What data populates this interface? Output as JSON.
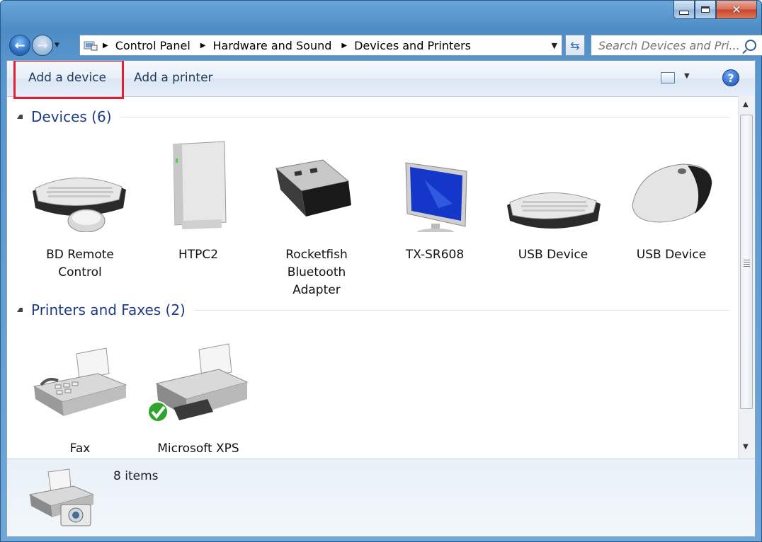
{
  "window": {
    "title": "Devices and Printers"
  },
  "nav": {
    "breadcrumbs": [
      "Control Panel",
      "Hardware and Sound",
      "Devices and Printers"
    ]
  },
  "search": {
    "placeholder": "Search Devices and Pri..."
  },
  "toolbar": {
    "add_device": "Add a device",
    "add_printer": "Add a printer",
    "help": "?"
  },
  "groups": {
    "devices": {
      "title": "Devices (6)",
      "items": [
        {
          "label": "BD Remote Control",
          "icon": "keyboard-mouse-icon"
        },
        {
          "label": "HTPC2",
          "icon": "computer-tower-icon"
        },
        {
          "label": "Rocketfish Bluetooth Adapter",
          "icon": "usb-dongle-icon"
        },
        {
          "label": "TX-SR608",
          "icon": "monitor-icon"
        },
        {
          "label": "USB Device",
          "icon": "keyboard-icon"
        },
        {
          "label": "USB Device",
          "icon": "mouse-icon"
        }
      ]
    },
    "printers": {
      "title": "Printers and Faxes (2)",
      "items": [
        {
          "label": "Fax",
          "icon": "fax-icon"
        },
        {
          "label": "Microsoft XPS Document Writer",
          "icon": "printer-icon"
        }
      ]
    }
  },
  "details": {
    "count": "8 items"
  },
  "colors": {
    "group_header": "#1e3b8a",
    "highlight": "#e0202e"
  }
}
